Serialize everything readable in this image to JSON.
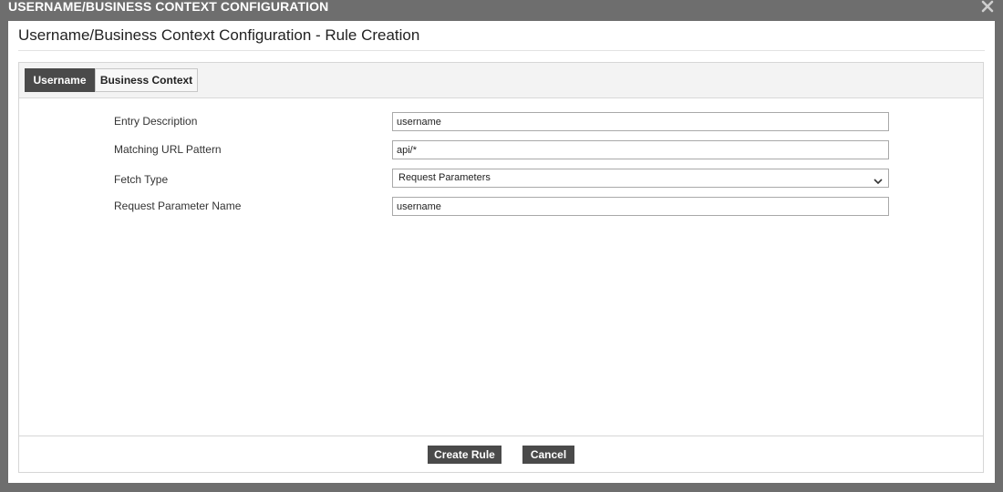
{
  "window": {
    "title": "USERNAME/BUSINESS CONTEXT CONFIGURATION",
    "close_icon": "close-icon"
  },
  "dialog": {
    "title": "Username/Business Context Configuration - Rule Creation"
  },
  "tabs": [
    {
      "label": "Username",
      "active": true
    },
    {
      "label": "Business Context",
      "active": false
    }
  ],
  "form": {
    "entry_description": {
      "label": "Entry Description",
      "value": "username"
    },
    "matching_url_pattern": {
      "label": "Matching URL Pattern",
      "value": "api/*"
    },
    "fetch_type": {
      "label": "Fetch Type",
      "value": "Request Parameters"
    },
    "request_parameter_name": {
      "label": "Request Parameter Name",
      "value": "username"
    }
  },
  "buttons": {
    "create_rule": "Create Rule",
    "cancel": "Cancel"
  },
  "colors": {
    "backdrop": "#6e6e6e",
    "active_tab": "#4a4a4a",
    "button": "#4a4a4a"
  }
}
